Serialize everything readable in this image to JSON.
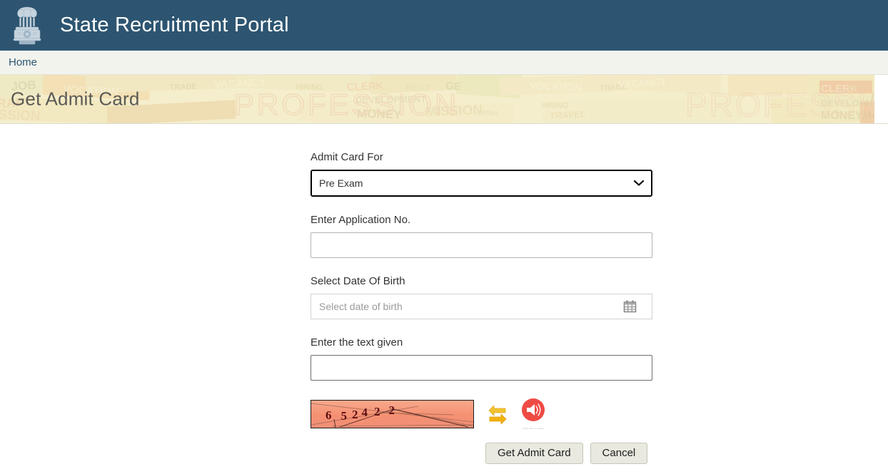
{
  "header": {
    "title": "State Recruitment Portal",
    "emblem_icon": "national-emblem-icon",
    "background_color": "#2d5571"
  },
  "navbar": {
    "items": [
      {
        "label": "Home"
      }
    ],
    "background_color": "#f3f3ee",
    "link_color": "#2d5571"
  },
  "banner": {
    "title": "Get Admit Card",
    "collage_words": [
      "VOCATION",
      "TRADE",
      "VACANCY",
      "PROFESSION",
      "CLERK",
      "BEST",
      "DEVELOPMENT",
      "MONEY",
      "MISSION",
      "HIRING",
      "TRAVEL",
      "CRAFT",
      "JOB",
      "MO",
      "IO"
    ],
    "background_color": "#f3ecc8"
  },
  "form": {
    "fields": {
      "admit_card_for": {
        "label": "Admit Card For",
        "selected": "Pre Exam",
        "options": [
          "Pre Exam"
        ]
      },
      "application_no": {
        "label": "Enter Application No.",
        "value": "",
        "placeholder": ""
      },
      "date_of_birth": {
        "label": "Select Date Of Birth",
        "value": "",
        "placeholder": "Select date of birth",
        "icon": "calendar-icon"
      },
      "captcha_text": {
        "label": "Enter the text given",
        "value": "",
        "placeholder": ""
      }
    },
    "captcha": {
      "code": "652422",
      "digits": [
        "6",
        "5",
        "2",
        "4",
        "2",
        "2"
      ],
      "refresh_icon": "refresh-icon",
      "audio_icon": "audio-speaker-icon",
      "audio_caption": "Click here to listen",
      "background_color": "#f59072",
      "text_color": "#5e0f12"
    },
    "buttons": {
      "submit": "Get Admit Card",
      "cancel": "Cancel"
    }
  }
}
